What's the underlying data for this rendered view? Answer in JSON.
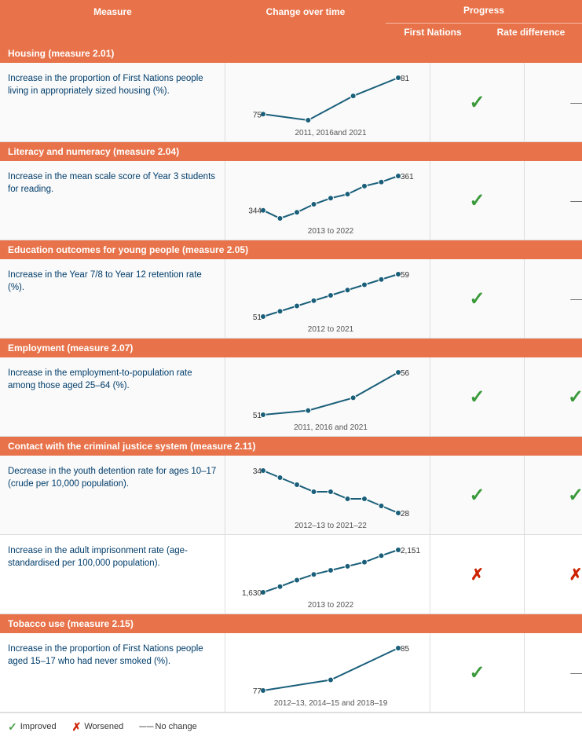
{
  "headers": {
    "measure": "Measure",
    "change_over_time": "Change over time",
    "progress": "Progress",
    "first_nations": "First Nations",
    "rate_difference": "Rate difference"
  },
  "sections": [
    {
      "id": "housing",
      "title": "Housing (measure 2.01)",
      "rows": [
        {
          "measure_text": "Increase in the proportion of First Nations people living in appropriately sized housing (%).",
          "chart": {
            "start_val": 75,
            "end_val": 81,
            "label": "2011, 2016and 2021",
            "points": [
              75,
              74,
              78,
              81
            ],
            "type": "increasing"
          },
          "first_nations": "check",
          "rate_difference": "dash"
        }
      ]
    },
    {
      "id": "literacy",
      "title": "Literacy and numeracy (measure 2.04)",
      "rows": [
        {
          "measure_text": "Increase in the mean scale score of Year 3 students for reading.",
          "chart": {
            "start_val": 344,
            "end_val": 361,
            "label": "2013 to 2022",
            "points": [
              344,
              340,
              343,
              347,
              350,
              352,
              356,
              358,
              361
            ],
            "type": "increasing"
          },
          "first_nations": "check",
          "rate_difference": "dash"
        }
      ]
    },
    {
      "id": "education",
      "title": "Education outcomes for young people (measure 2.05)",
      "rows": [
        {
          "measure_text": "Increase in the Year 7/8 to Year 12 retention rate (%).",
          "chart": {
            "start_val": 51,
            "end_val": 59,
            "label": "2012 to 2021",
            "points": [
              51,
              52,
              53,
              54,
              55,
              56,
              57,
              58,
              59
            ],
            "type": "increasing"
          },
          "first_nations": "check",
          "rate_difference": "dash"
        }
      ]
    },
    {
      "id": "employment",
      "title": "Employment (measure 2.07)",
      "rows": [
        {
          "measure_text": "Increase in the employment-to-population rate among those aged 25–64 (%).",
          "chart": {
            "start_val": 51,
            "end_val": 56,
            "label": "2011, 2016 and 2021",
            "points": [
              51,
              51.5,
              53,
              56
            ],
            "type": "increasing"
          },
          "first_nations": "check",
          "rate_difference": "check"
        }
      ]
    },
    {
      "id": "criminal",
      "title": "Contact with the criminal justice system (measure 2.11)",
      "rows": [
        {
          "measure_text": "Decrease in the youth detention rate for ages 10–17 (crude per 10,000 population).",
          "chart": {
            "start_val": 34,
            "end_val": 28,
            "label": "2012–13 to 2021–22",
            "points": [
              34,
              33,
              32,
              31,
              31,
              30,
              30,
              29,
              28
            ],
            "type": "decreasing"
          },
          "first_nations": "check",
          "rate_difference": "check"
        },
        {
          "measure_text": "Increase in the adult imprisonment rate (age-standardised per 100,000 population).",
          "chart": {
            "start_val": 1630,
            "end_val": 2151,
            "label": "2013 to 2022",
            "points": [
              1630,
              1700,
              1780,
              1850,
              1900,
              1950,
              2000,
              2080,
              2151
            ],
            "type": "increasing_bad"
          },
          "first_nations": "cross",
          "rate_difference": "cross"
        }
      ]
    },
    {
      "id": "tobacco",
      "title": "Tobacco use (measure 2.15)",
      "rows": [
        {
          "measure_text": "Increase in the proportion of First Nations people aged 15–17 who had never smoked (%).",
          "chart": {
            "start_val": 77,
            "end_val": 85,
            "label": "2012–13, 2014–15 and 2018–19",
            "points": [
              77,
              79,
              85
            ],
            "type": "increasing"
          },
          "first_nations": "check",
          "rate_difference": "dash"
        }
      ]
    }
  ],
  "legend": {
    "improved": "Improved",
    "worsened": "Worsened",
    "no_change": "No change",
    "check_symbol": "✓",
    "cross_symbol": "✗",
    "dash_symbol": "– –"
  }
}
